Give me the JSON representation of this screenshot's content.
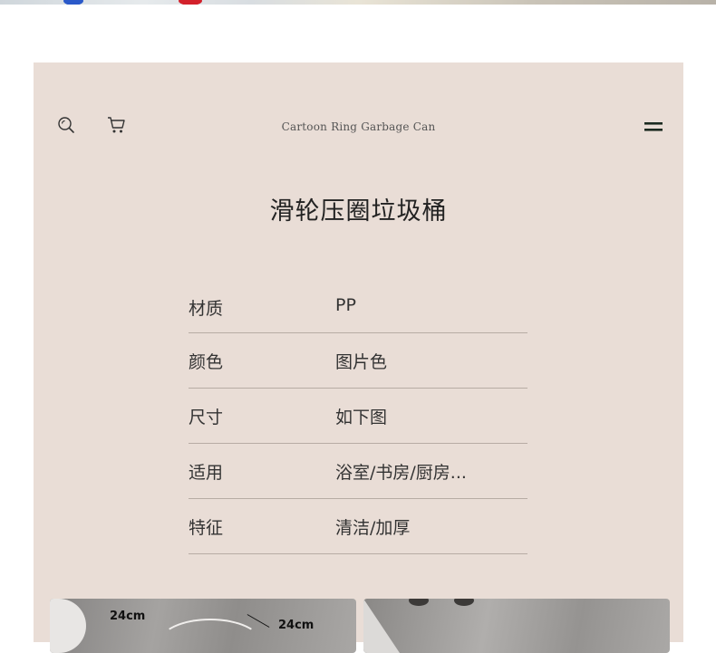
{
  "header": {
    "brand_title": "Cartoon Ring Garbage Can",
    "icons": [
      "search-icon",
      "cart-icon",
      "menu-icon"
    ]
  },
  "product": {
    "title": "滑轮压圈垃圾桶"
  },
  "specs": [
    {
      "key": "材质",
      "value": "PP"
    },
    {
      "key": "颜色",
      "value": "图片色"
    },
    {
      "key": "尺寸",
      "value": "如下图"
    },
    {
      "key": "适用",
      "value": "浴室/书房/厨房..."
    },
    {
      "key": "特征",
      "value": "清洁/加厚"
    }
  ],
  "photos": {
    "left": {
      "dim_a": "24cm",
      "dim_b": "24cm"
    }
  },
  "colors": {
    "card_background": "#e9ddd6",
    "divider": "#b7aca4",
    "text": "#333333"
  }
}
